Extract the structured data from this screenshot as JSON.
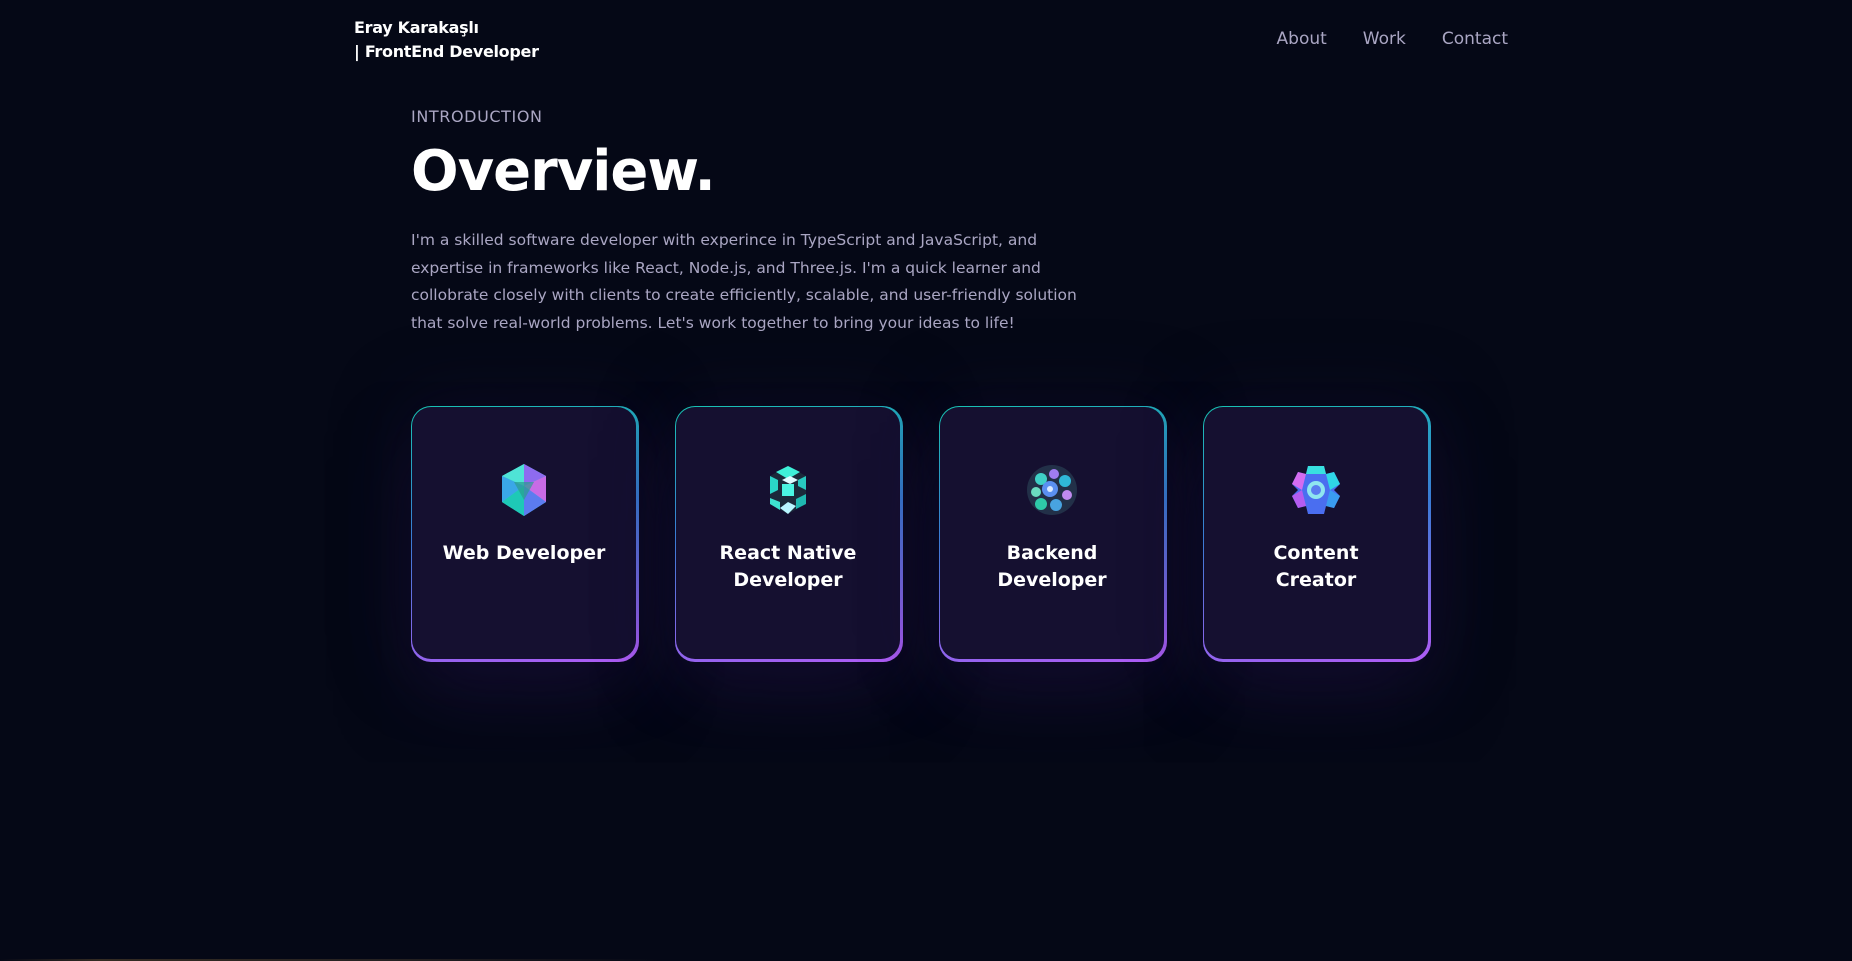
{
  "navbar": {
    "brand_line1": "Eray Karakaşlı",
    "brand_line2": "| FrontEnd Developer",
    "links": [
      "About",
      "Work",
      "Contact"
    ]
  },
  "intro": {
    "subtitle": "Introduction",
    "title": "Overview.",
    "text": "I'm a skilled software developer with experince in TypeScript and JavaScript, and expertise in frameworks like React, Node.js, and Three.js. I'm a quick learner and collobrate closely with clients to create efficiently, scalable, and user-friendly solution that solve real-world problems. Let's work together to bring your ideas to life!"
  },
  "services": [
    {
      "title": "Web Developer",
      "icon": "web-developer-icon"
    },
    {
      "title": "React Native Developer",
      "icon": "react-native-icon"
    },
    {
      "title": "Backend Developer",
      "icon": "backend-icon"
    },
    {
      "title": "Content Creator",
      "icon": "content-creator-icon"
    }
  ],
  "colors": {
    "background": "#050816",
    "card": "#151030",
    "secondary_text": "#aaa6c3",
    "border_gradient_start": "#17c3b2",
    "border_gradient_end": "#b05cf6"
  }
}
